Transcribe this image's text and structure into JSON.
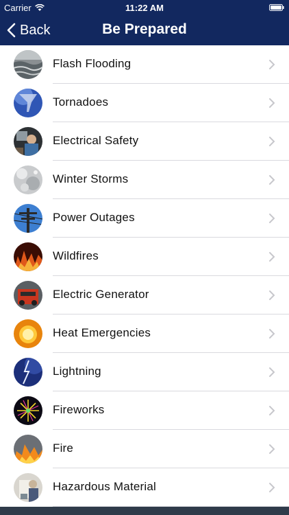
{
  "status": {
    "carrier": "Carrier",
    "time": "11:22 AM"
  },
  "nav": {
    "back_label": "Back",
    "title": "Be Prepared"
  },
  "items": [
    {
      "label": "Flash Flooding",
      "icon": "flash-flooding-photo"
    },
    {
      "label": "Tornadoes",
      "icon": "tornado-photo"
    },
    {
      "label": "Electrical Safety",
      "icon": "electrical-safety-photo"
    },
    {
      "label": "Winter Storms",
      "icon": "winter-storm-photo"
    },
    {
      "label": "Power Outages",
      "icon": "power-lines-photo"
    },
    {
      "label": "Wildfires",
      "icon": "wildfire-photo"
    },
    {
      "label": "Electric Generator",
      "icon": "generator-photo"
    },
    {
      "label": "Heat Emergencies",
      "icon": "sun-photo"
    },
    {
      "label": "Lightning",
      "icon": "lightning-photo"
    },
    {
      "label": "Fireworks",
      "icon": "fireworks-photo"
    },
    {
      "label": "Fire",
      "icon": "fire-photo"
    },
    {
      "label": "Hazardous Material",
      "icon": "hazmat-photo"
    }
  ],
  "colors": {
    "nav_background": "#12285f",
    "separator": "#d9d9de",
    "chevron": "#c7c7cc"
  }
}
